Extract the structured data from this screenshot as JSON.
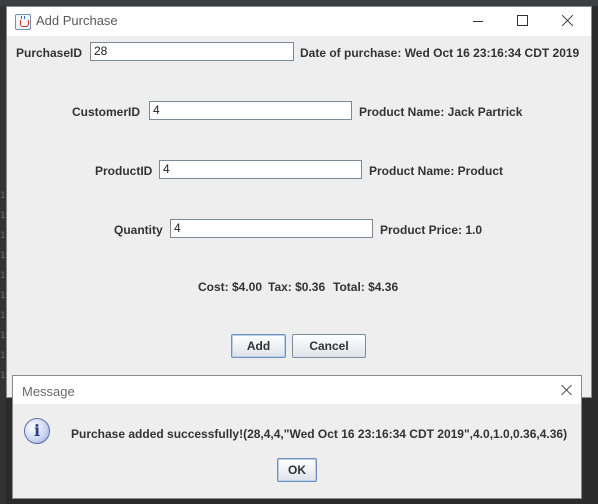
{
  "window": {
    "title": "Add Purchase"
  },
  "form": {
    "purchase_id": {
      "label": "PurchaseID",
      "value": "28"
    },
    "date_of_purchase": "Date of purchase: Wed Oct 16 23:16:34 CDT 2019",
    "customer_id": {
      "label": "CustomerID",
      "value": "4"
    },
    "customer_name": "Product Name: Jack Partrick",
    "product_id": {
      "label": "ProductID",
      "value": "4"
    },
    "product_name": "Product Name: Product",
    "quantity": {
      "label": "Quantity",
      "value": "4"
    },
    "product_price": "Product Price: 1.0",
    "cost": "Cost: $4.00",
    "tax": "Tax: $0.36",
    "total": "Total: $4.36"
  },
  "buttons": {
    "add": "Add",
    "cancel": "Cancel"
  },
  "message_dialog": {
    "title": "Message",
    "icon": "info-icon",
    "text": "Purchase added successfully!(28,4,4,\"Wed Oct 16 23:16:34 CDT 2019\",4.0,1.0,0.36,4.36)",
    "ok": "OK"
  },
  "background": {
    "gutter_numbers": [
      "1",
      "1",
      "1",
      "1",
      "1",
      "1",
      "1",
      "1",
      "1",
      "1"
    ]
  }
}
